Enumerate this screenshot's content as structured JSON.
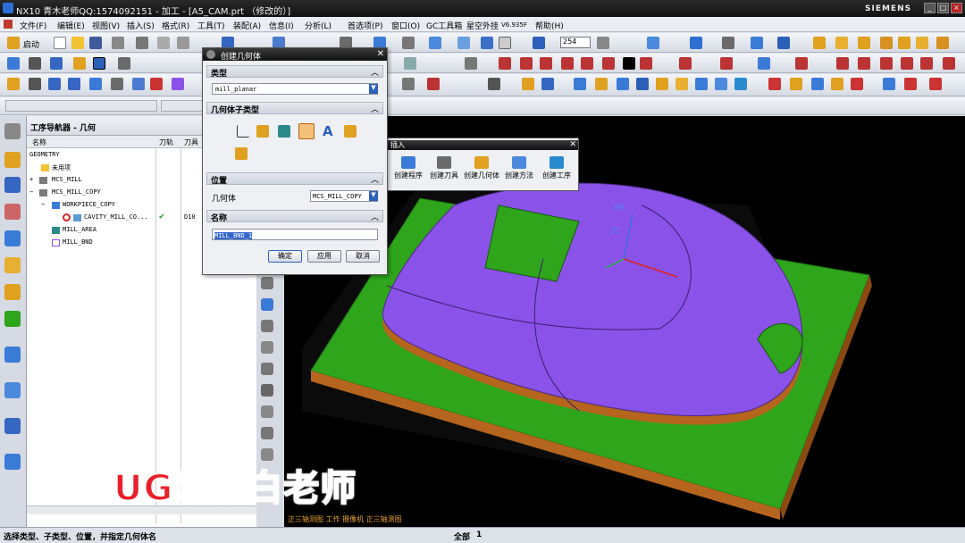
{
  "window": {
    "title": "NX10 青木老师QQ:1574092151 - 加工 - [A5_CAM.prt （修改的）]",
    "brand": "SIEMENS"
  },
  "menu": [
    "文件(F)",
    "编辑(E)",
    "视图(V)",
    "插入(S)",
    "格式(R)",
    "工具(T)",
    "装配(A)",
    "信息(I)",
    "分析(L)",
    "首选项(P)",
    "窗口(O)",
    "GC工具箱",
    "星空外挂",
    "V6.935F",
    "帮助(H)"
  ],
  "toolbar": {
    "start_label": "启动",
    "zoom_value": "254"
  },
  "navigator": {
    "title": "工序导航器 - 几何",
    "columns": [
      "名称",
      "刀轨",
      "刀具"
    ],
    "rows": [
      {
        "name": "GEOMETRY"
      },
      {
        "name": "未用项"
      },
      {
        "name": "MCS_MILL"
      },
      {
        "name": "MCS_MILL_COPY"
      },
      {
        "name": "WORKPIECE_COPY"
      },
      {
        "name": "CAVITY_MILL_CO...",
        "tool": "D10"
      },
      {
        "name": "MILL_AREA"
      },
      {
        "name": "MILL_BND"
      }
    ]
  },
  "dialog": {
    "title": "创建几何体",
    "type_section": "类型",
    "type_value": "mill_planar",
    "subtype_section": "几何体子类型",
    "position_section": "位置",
    "parent_label": "几何体",
    "parent_value": "MCS_MILL_COPY",
    "name_section": "名称",
    "name_value": "MILL_BND_1",
    "ok": "确定",
    "apply": "应用",
    "cancel": "取消"
  },
  "insert_toolbar": {
    "title": "插入",
    "items": [
      "创建程序",
      "创建刀具",
      "创建几何体",
      "创建方法",
      "创建工序"
    ]
  },
  "viewport": {
    "view_info": "正三轴测图  工作 摄像机 正三轴测图",
    "axis_zm": "ZM",
    "axis_zc": "ZC"
  },
  "status": {
    "prompt": "选择类型、子类型、位置，并指定几何体名",
    "filter": "全部",
    "count": "1"
  },
  "watermark": "星航UG网耀白老师",
  "colors": {
    "part": "#8a52e8",
    "base": "#2fa51c",
    "side": "#b5651d"
  }
}
